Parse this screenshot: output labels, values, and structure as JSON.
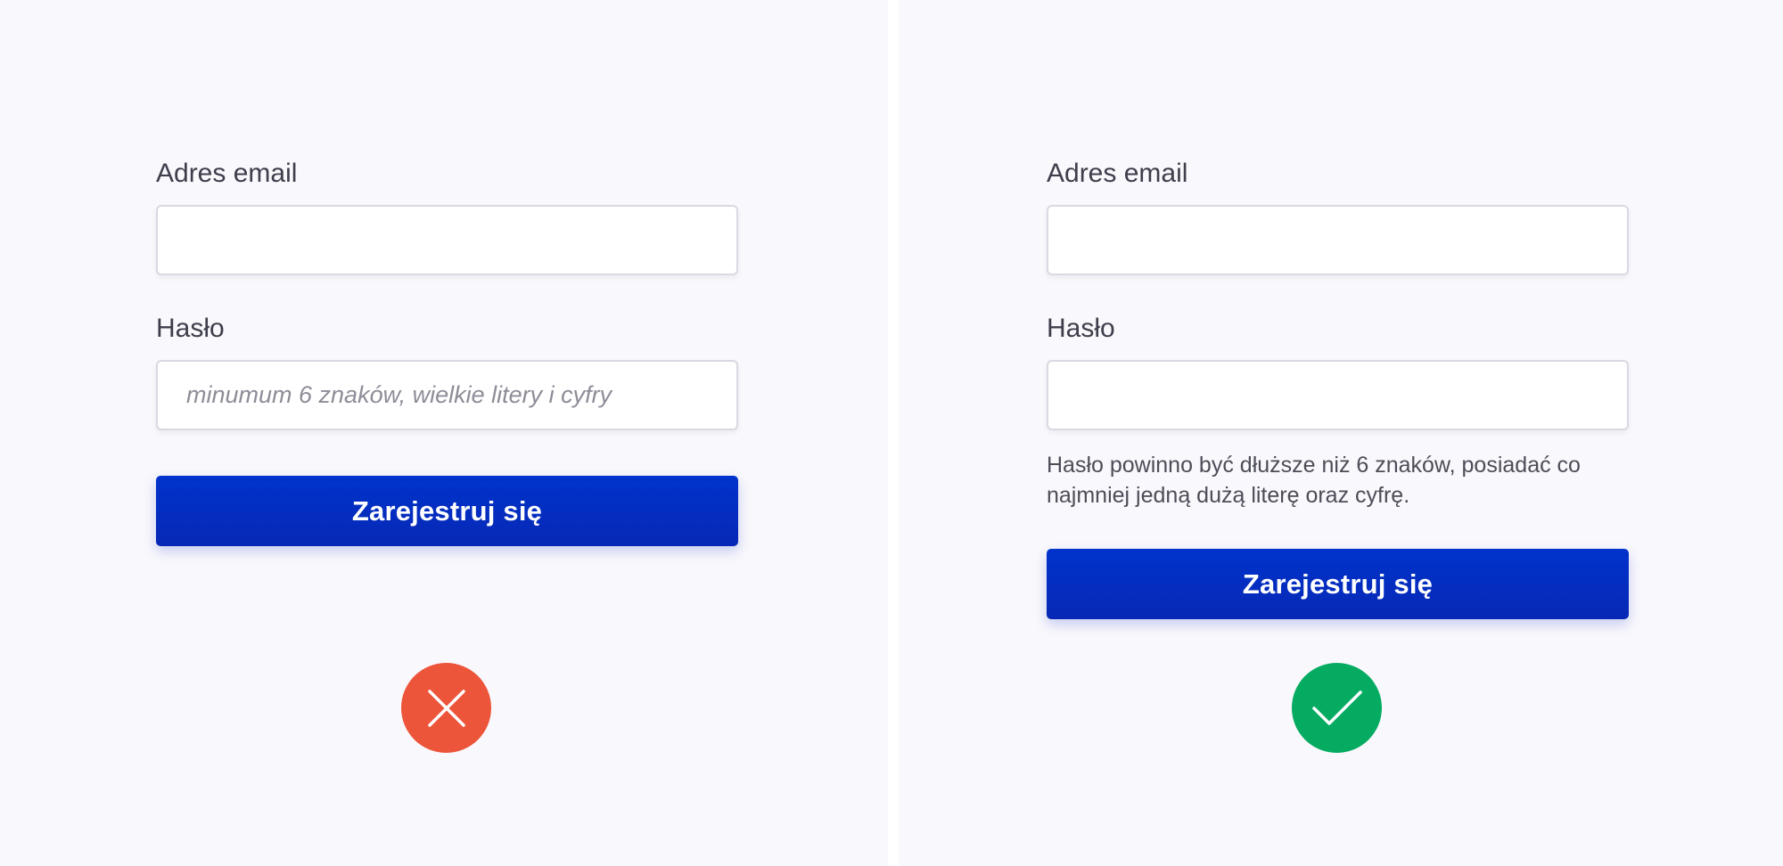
{
  "colors": {
    "background": "#f9f8fc",
    "primary_button": "#0033cc",
    "error": "#ec553a",
    "success": "#04ab61"
  },
  "bad_example": {
    "email_label": "Adres email",
    "password_label": "Hasło",
    "password_placeholder": "minumum 6 znaków, wielkie litery i cyfry",
    "submit_label": "Zarejestruj się",
    "status_icon": "close-icon"
  },
  "good_example": {
    "email_label": "Adres email",
    "password_label": "Hasło",
    "password_hint": "Hasło powinno być dłuższe niż 6 znaków, posiadać co najmniej jedną dużą literę oraz cyfrę.",
    "submit_label": "Zarejestruj się",
    "status_icon": "check-icon"
  }
}
